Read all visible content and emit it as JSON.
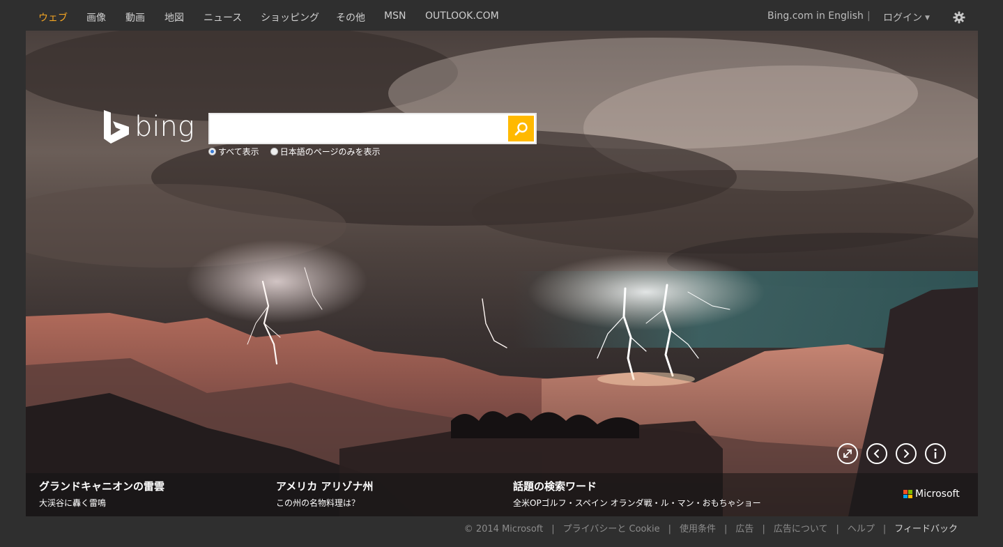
{
  "nav": {
    "items": [
      {
        "label": "ウェブ",
        "active": true
      },
      {
        "label": "画像"
      },
      {
        "label": "動画"
      },
      {
        "label": "地図"
      },
      {
        "label": "ニュース"
      },
      {
        "label": "ショッピング"
      },
      {
        "label": "その他"
      },
      {
        "label": "MSN"
      },
      {
        "label": "OUTLOOK.COM"
      }
    ],
    "english_link": "Bing.com in English",
    "separator": "|",
    "login": "ログイン",
    "settings_icon": "gear-icon",
    "accent_color": "#f5a623"
  },
  "logo": {
    "text": "bing"
  },
  "search": {
    "value": "",
    "placeholder": "",
    "button_icon": "search-icon",
    "button_color": "#ffb900",
    "options": [
      {
        "label": "すべて表示",
        "selected": true
      },
      {
        "label": "日本語のページのみを表示",
        "selected": false
      }
    ]
  },
  "controls": {
    "fullscreen_icon": "expand-icon",
    "prev_icon": "chevron-left-icon",
    "next_icon": "chevron-right-icon",
    "info_icon": "info-icon"
  },
  "stories": [
    {
      "title": "グランドキャニオンの雷雲",
      "subtitle": "大渓谷に轟く雷鳴"
    },
    {
      "title": "アメリカ アリゾナ州",
      "subtitle": "この州の名物料理は？"
    },
    {
      "title": "話題の検索ワード",
      "subtitle": "全米OPゴルフ・スペイン オランダ戦・ル・マン・おもちゃショー"
    }
  ],
  "brand": {
    "microsoft": "Microsoft"
  },
  "footer": {
    "copyright": "© 2014 Microsoft",
    "separator": "|",
    "privacy": "プライバシーと Cookie",
    "terms": "使用条件",
    "ads": "広告",
    "about_ads": "広告について",
    "help": "ヘルプ",
    "feedback": "フィードバック"
  }
}
